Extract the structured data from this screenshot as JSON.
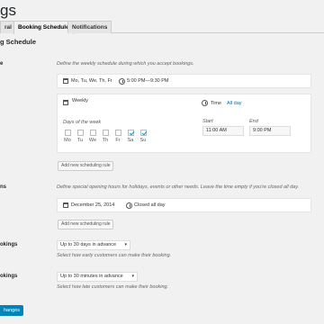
{
  "page": {
    "title": "gs"
  },
  "tabs": [
    {
      "label": "ral",
      "active": false
    },
    {
      "label": "Booking Schedule",
      "active": true
    },
    {
      "label": "Notifications",
      "active": false
    }
  ],
  "section": {
    "title": "g Schedule"
  },
  "schedule": {
    "label": "e",
    "description": "Define the weekly schedule during which you accept bookings.",
    "rule1": {
      "days": "Mo, Tu, We, Th, Fr",
      "time": "5:00 PM—9:30 PM"
    },
    "rule2": {
      "frequency": "Weekly",
      "time_label": "Time",
      "all_day_label": "All day",
      "days_label": "Days of the week",
      "days": [
        "Mo",
        "Tu",
        "We",
        "Th",
        "Fr",
        "Sa",
        "Su"
      ],
      "checked": [
        false,
        false,
        false,
        false,
        false,
        true,
        true
      ],
      "start_label": "Start",
      "start_value": "11:00 AM",
      "end_label": "End",
      "end_value": "9:00 PM"
    },
    "add_button": "Add new scheduling rule"
  },
  "exceptions": {
    "label": "ns",
    "description": "Define special opening hours for holidays, events or other needs. Leave the time empty if you're closed all day.",
    "rule1": {
      "date": "December 25, 2014",
      "status": "Closed all day"
    },
    "add_button": "Add new scheduling rule"
  },
  "early": {
    "label": "okings",
    "value": "Up to 30 days in advance",
    "description": "Select how early customers can make their booking."
  },
  "late": {
    "label": "okings",
    "value": "Up to 30 minutes in advance",
    "description": "Select how late customers can make their booking."
  },
  "save_button": "hanges"
}
